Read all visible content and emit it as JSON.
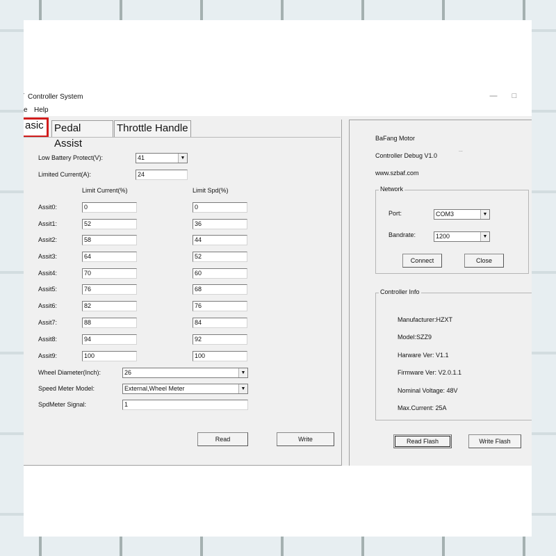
{
  "window": {
    "title": "Controller System",
    "title_glyph": "⁄"
  },
  "menu": {
    "file_fragment": "e",
    "help": "Help"
  },
  "tabs": {
    "basic": "asic",
    "pedal": "Pedal Assist",
    "throttle": "Throttle Handle"
  },
  "basic": {
    "low_battery_label": "Low Battery Protect(V):",
    "low_battery_value": "41",
    "limited_current_label": "Limited Current(A):",
    "limited_current_value": "24",
    "limit_current_header": "Limit Current(%)",
    "limit_spd_header": "Limit Spd(%)",
    "assists": [
      {
        "label": "Assit0:",
        "current": "0",
        "speed": "0"
      },
      {
        "label": "Assit1:",
        "current": "52",
        "speed": "36"
      },
      {
        "label": "Assit2:",
        "current": "58",
        "speed": "44"
      },
      {
        "label": "Assit3:",
        "current": "64",
        "speed": "52"
      },
      {
        "label": "Assit4:",
        "current": "70",
        "speed": "60"
      },
      {
        "label": "Assit5:",
        "current": "76",
        "speed": "68"
      },
      {
        "label": "Assit6:",
        "current": "82",
        "speed": "76"
      },
      {
        "label": "Assit7:",
        "current": "88",
        "speed": "84"
      },
      {
        "label": "Assit8:",
        "current": "94",
        "speed": "92"
      },
      {
        "label": "Assit9:",
        "current": "100",
        "speed": "100"
      }
    ],
    "wheel_label": "Wheel Diameter(Inch):",
    "wheel_value": "26",
    "speed_meter_label": "Speed Meter Model:",
    "speed_meter_value": "External,Wheel Meter",
    "spd_signal_label": "SpdMeter Signal:",
    "spd_signal_value": "1",
    "read_button": "Read",
    "write_button": "Write"
  },
  "info": {
    "line1": "BaFang Motor",
    "line2": "Controller Debug V1.0",
    "line2_suffix": "...",
    "line3": "www.szbaf.com"
  },
  "network": {
    "legend": "Network",
    "port_label": "Port:",
    "port_value": "COM3",
    "bandrate_label": "Bandrate:",
    "bandrate_value": "1200",
    "connect_button": "Connect",
    "close_button": "Close"
  },
  "controller_info": {
    "legend": "Controller Info",
    "manufacturer": "Manufacturer:HZXT",
    "model": "Model:SZZ9",
    "hardware": "Harware Ver: V1.1",
    "firmware": "Firmware Ver: V2.0.1.1",
    "voltage": "Nominal Voltage: 48V",
    "max_current": "Max.Current: 25A"
  },
  "flash": {
    "read_button": "Read Flash",
    "write_button": "Write Flash"
  },
  "icons": {
    "minimize": "minimize-icon",
    "maximize": "maximize-icon",
    "dropdown": "chevron-down-icon"
  }
}
